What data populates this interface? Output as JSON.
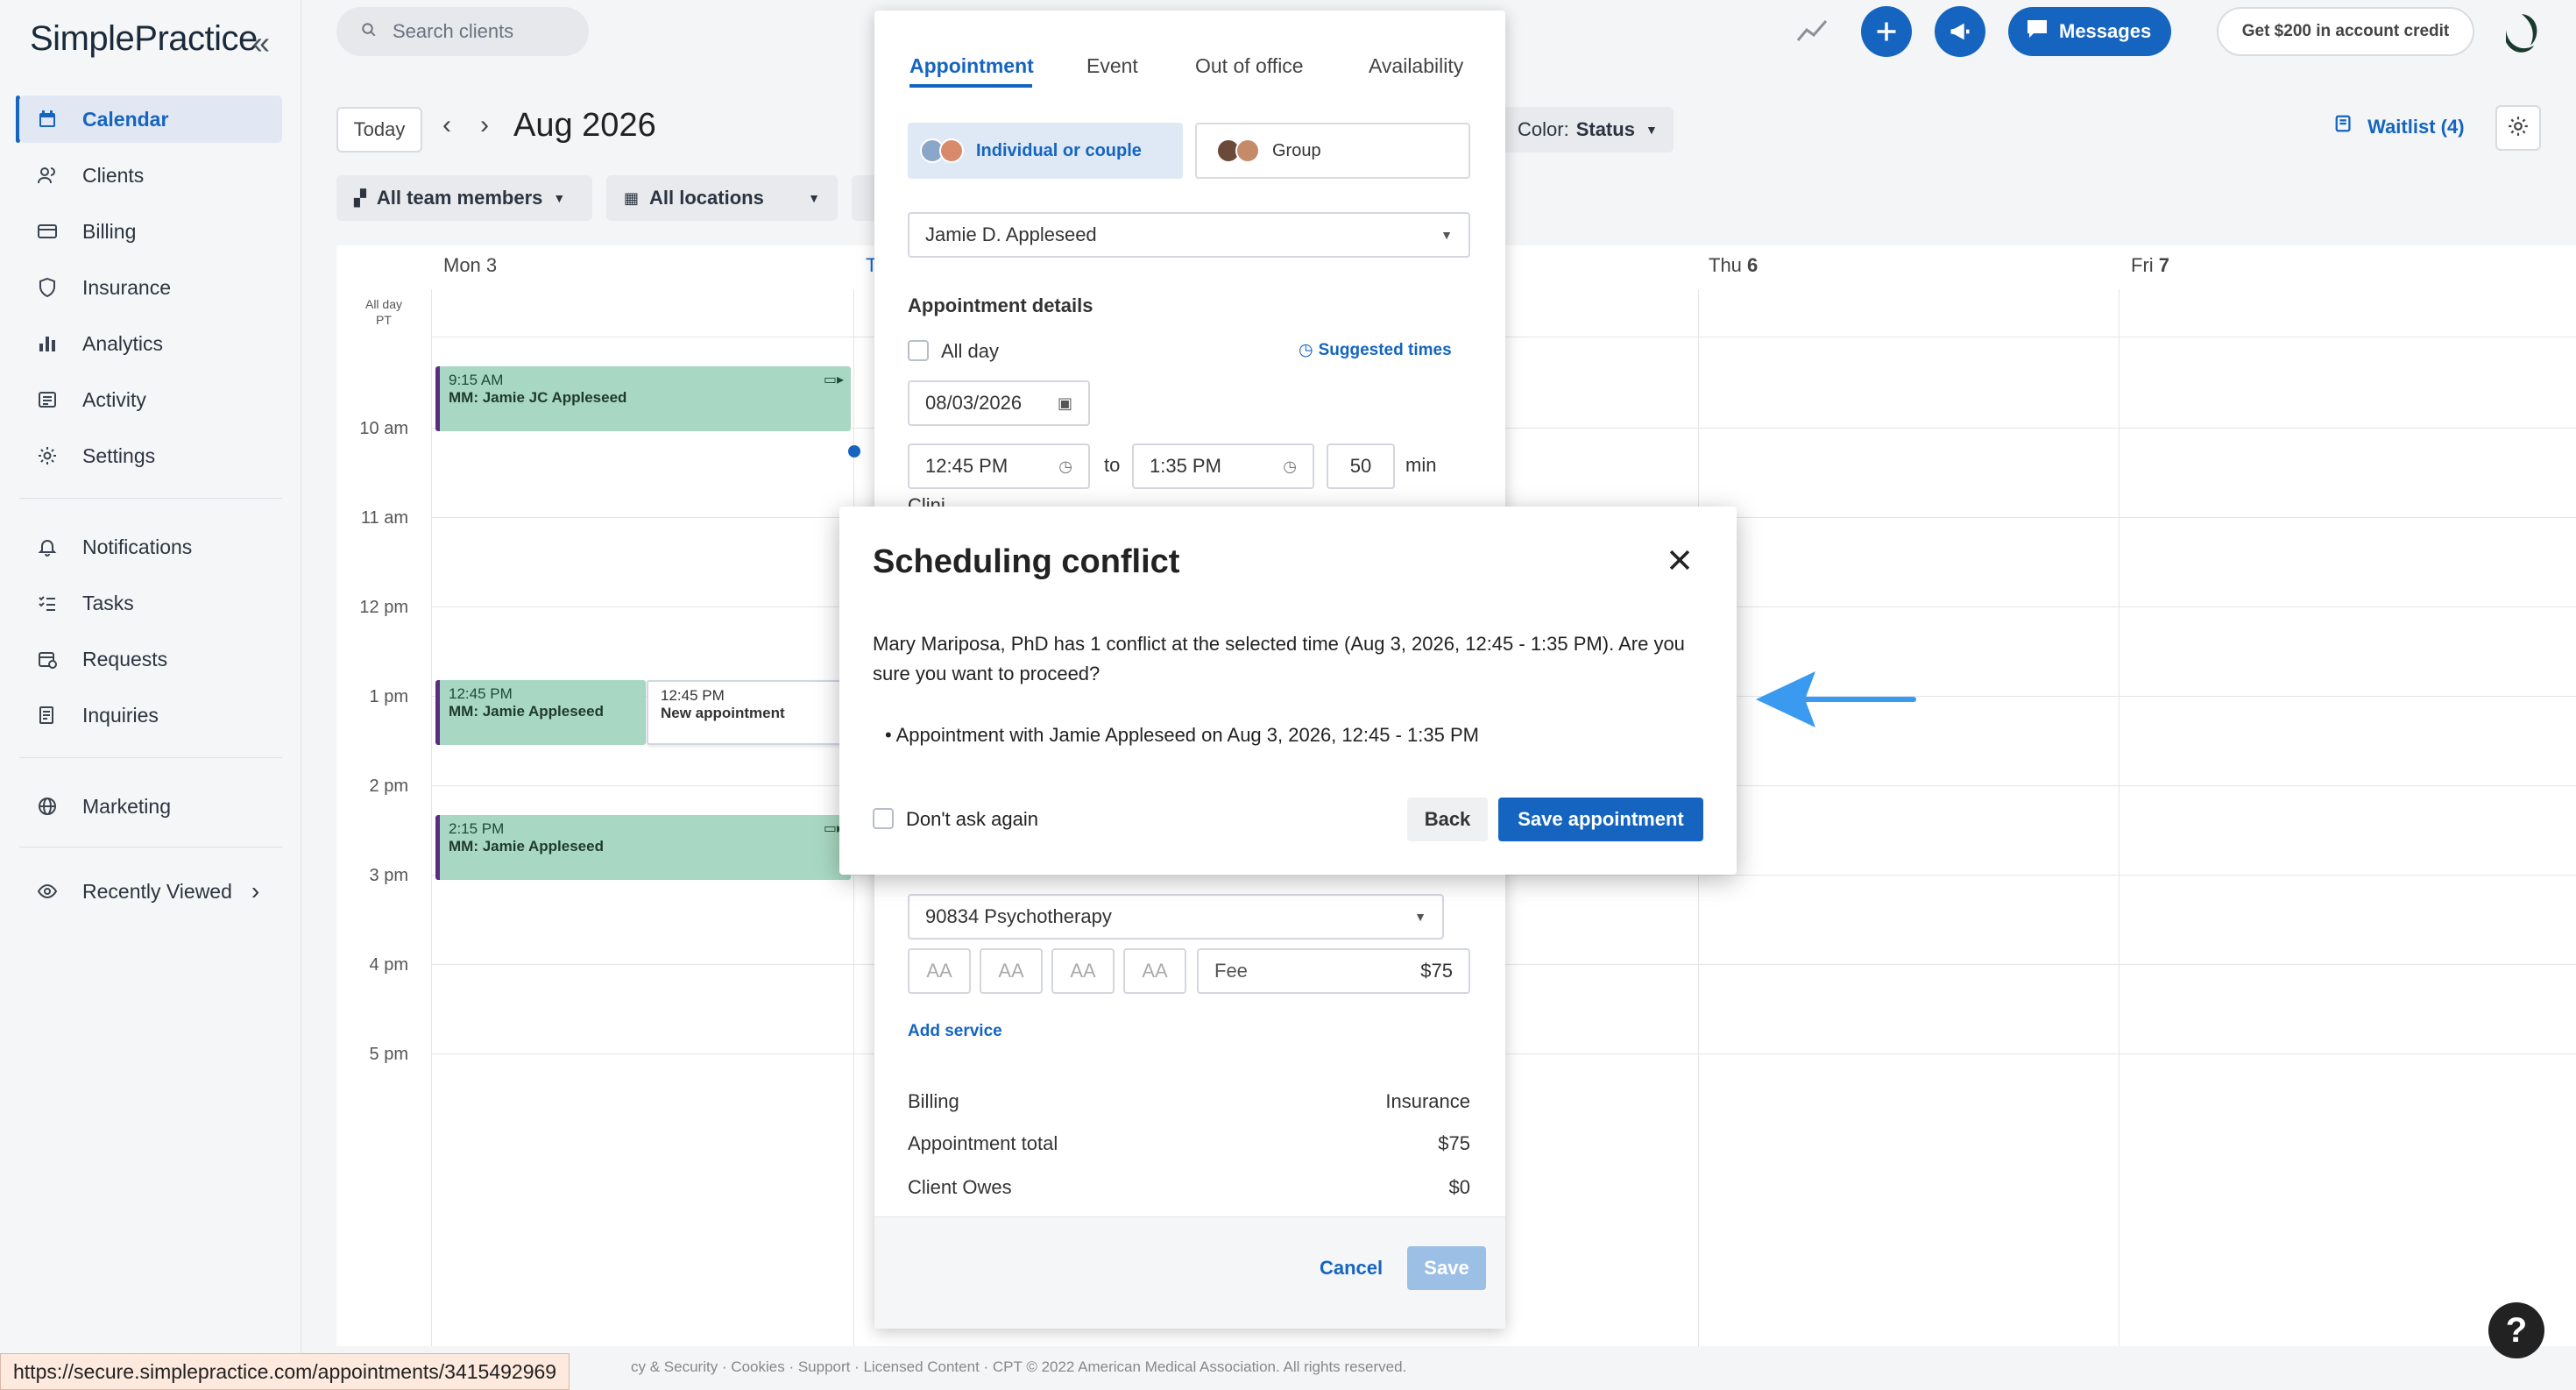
{
  "app": {
    "logo": "SimplePractice",
    "collapse_icon": "double-chevron-left-icon"
  },
  "sidebar": {
    "items": [
      {
        "label": "Calendar",
        "icon": "calendar-icon",
        "active": true
      },
      {
        "label": "Clients",
        "icon": "users-icon"
      },
      {
        "label": "Billing",
        "icon": "credit-card-icon"
      },
      {
        "label": "Insurance",
        "icon": "shield-icon"
      },
      {
        "label": "Analytics",
        "icon": "bar-chart-icon"
      },
      {
        "label": "Activity",
        "icon": "list-icon"
      },
      {
        "label": "Settings",
        "icon": "gear-icon"
      },
      {
        "label": "Notifications",
        "icon": "bell-icon"
      },
      {
        "label": "Tasks",
        "icon": "checklist-icon"
      },
      {
        "label": "Requests",
        "icon": "calendar-plus-icon"
      },
      {
        "label": "Inquiries",
        "icon": "document-icon"
      },
      {
        "label": "Marketing",
        "icon": "globe-icon"
      },
      {
        "label": "Recently Viewed",
        "icon": "eye-icon"
      }
    ]
  },
  "topbar": {
    "search_placeholder": "Search clients",
    "messages_label": "Messages",
    "credit_label": "Get $200 in account credit"
  },
  "toolbar": {
    "today": "Today",
    "month": "Aug 2026",
    "team_filter": "All team members",
    "location_filter": "All locations",
    "color_label": "Color:",
    "color_value": "Status",
    "waitlist": "Waitlist (4)"
  },
  "calendar": {
    "days": [
      {
        "name": "Mon",
        "num": "3"
      },
      {
        "name": "T",
        "num": ""
      },
      {
        "name": "Thu",
        "num": "6"
      },
      {
        "name": "Fri",
        "num": "7"
      }
    ],
    "allday_label": "All day",
    "tz_label": "PT",
    "hours": [
      "10 am",
      "11 am",
      "12 pm",
      "1 pm",
      "2 pm",
      "3 pm",
      "4 pm",
      "5 pm"
    ],
    "events": [
      {
        "time": "9:15 AM",
        "title": "MM: Jamie JC Appleseed"
      },
      {
        "time": "12:45 PM",
        "title": "MM: Jamie Appleseed"
      },
      {
        "time": "2:15 PM",
        "title": "MM: Jamie Appleseed"
      }
    ],
    "new_appt": {
      "time": "12:45 PM",
      "title": "New appointment"
    }
  },
  "panel": {
    "tabs": [
      "Appointment",
      "Event",
      "Out of office",
      "Availability"
    ],
    "client_type_individual": "Individual or couple",
    "client_type_group": "Group",
    "client": "Jamie D. Appleseed",
    "details_heading": "Appointment details",
    "all_day": "All day",
    "suggested_times": "Suggested times",
    "date": "08/03/2026",
    "start_time": "12:45 PM",
    "to": "to",
    "end_time": "1:35 PM",
    "duration": "50",
    "duration_unit": "min",
    "partial_label": "Clini",
    "service": "90834 Psychotherapy",
    "modifiers": [
      "AA",
      "AA",
      "AA",
      "AA"
    ],
    "fee_label": "Fee",
    "fee_value": "$75",
    "add_service": "Add service",
    "billing_label": "Billing",
    "billing_value": "Insurance",
    "total_label": "Appointment total",
    "total_value": "$75",
    "owes_label": "Client Owes",
    "owes_value": "$0",
    "cancel": "Cancel",
    "save": "Save"
  },
  "modal": {
    "title": "Scheduling conflict",
    "message": "Mary Mariposa, PhD has 1 conflict at the selected time (Aug 3, 2026, 12:45 - 1:35 PM). Are you sure you want to proceed?",
    "bullet": "Appointment with Jamie Appleseed on Aug 3, 2026, 12:45 - 1:35 PM",
    "dont_ask": "Don't ask again",
    "back": "Back",
    "save_appointment": "Save appointment"
  },
  "footer": {
    "links": "cy & Security · Cookies · Support · Licensed Content · CPT © 2022 American Medical Association. All rights reserved.",
    "status_url": "https://secure.simplepractice.com/appointments/3415492969"
  },
  "help": "?"
}
